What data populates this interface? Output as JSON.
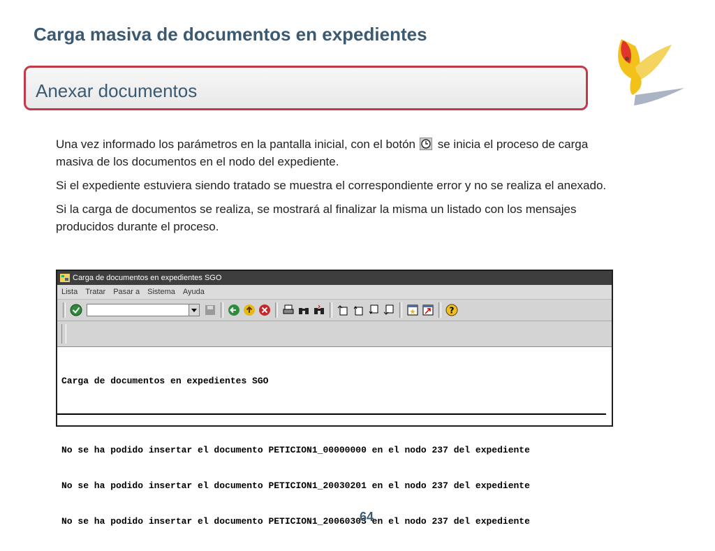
{
  "slide": {
    "title": "Carga masiva de documentos en expedientes",
    "section_title": "Anexar documentos",
    "paragraphs": [
      "Una vez informado los parámetros en la pantalla inicial, con el botón",
      "se inicia el proceso de carga masiva de los documentos en el nodo del expediente.",
      "Si el expediente estuviera siendo tratado se muestra el correspondiente error y no se realiza el anexado.",
      "Si la carga de documentos se realiza, se mostrará al finalizar la misma un listado con los mensajes producidos durante el proceso."
    ],
    "page_number": "64"
  },
  "sap": {
    "window_title": "Carga de documentos en expedientes SGO",
    "menu": [
      "Lista",
      "Tratar",
      "Pasar a",
      "Sistema",
      "Ayuda"
    ],
    "command_field": {
      "value": ""
    },
    "list_header": "Carga de documentos en expedientes SGO",
    "messages": [
      "No se ha podido insertar el documento PETICION1_00000000 en el nodo 237 del expediente",
      "No se ha podido insertar el documento PETICION1_20030201 en el nodo 237 del expediente",
      "No se ha podido insertar el documento PETICION1_20060303 en el nodo 237 del expediente"
    ]
  },
  "colors": {
    "title": "#3b5a72",
    "section_border": "#c23a4a",
    "sap_titlebar": "#3e3e3e"
  }
}
